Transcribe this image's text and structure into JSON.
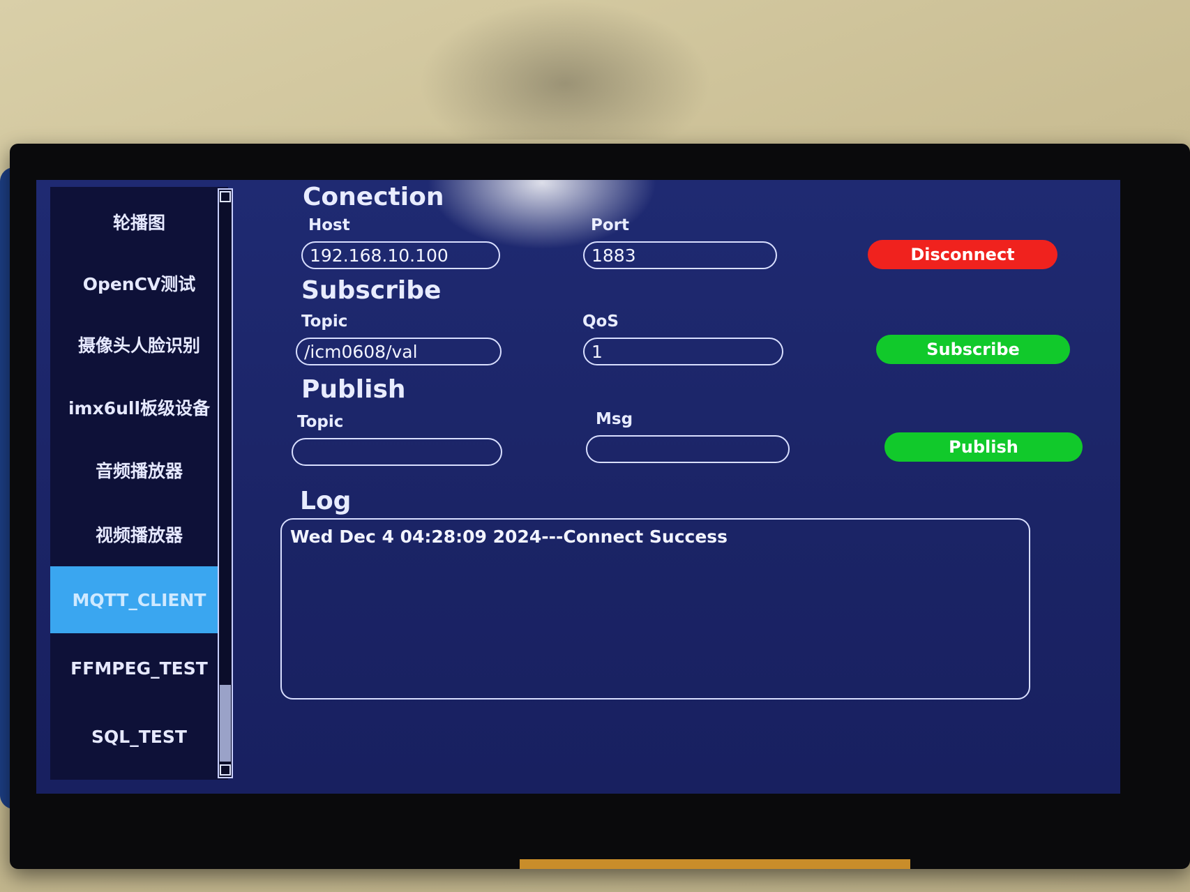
{
  "sidebar": {
    "items": [
      {
        "label": "轮播图"
      },
      {
        "label": "OpenCV测试"
      },
      {
        "label": "摄像头人脸识别"
      },
      {
        "label": "imx6ull板级设备"
      },
      {
        "label": "音频播放器"
      },
      {
        "label": "视频播放器"
      },
      {
        "label": "MQTT_CLIENT"
      },
      {
        "label": "FFMPEG_TEST"
      },
      {
        "label": "SQL_TEST"
      }
    ],
    "active_index": 6
  },
  "connection": {
    "title": "Conection",
    "host_label": "Host",
    "host_value": "192.168.10.100",
    "port_label": "Port",
    "port_value": "1883",
    "button_label": "Disconnect"
  },
  "subscribe": {
    "title": "Subscribe",
    "topic_label": "Topic",
    "topic_value": "/icm0608/val",
    "qos_label": "QoS",
    "qos_value": "1",
    "button_label": "Subscribe"
  },
  "publish": {
    "title": "Publish",
    "topic_label": "Topic",
    "topic_value": "",
    "msg_label": "Msg",
    "msg_value": "",
    "button_label": "Publish"
  },
  "log": {
    "title": "Log",
    "lines": [
      "Wed Dec 4 04:28:09 2024---Connect Success"
    ]
  },
  "colors": {
    "disconnect": "#f0221e",
    "action": "#11c92b",
    "active_nav": "#3aa6f0",
    "screen_bg": "#1f2a72"
  }
}
